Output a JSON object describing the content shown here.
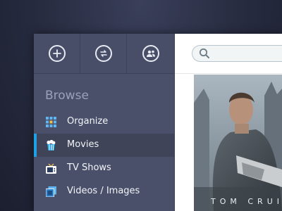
{
  "sidebar": {
    "heading": "Browse",
    "toolbar": [
      {
        "icon": "add-icon"
      },
      {
        "icon": "sync-icon"
      },
      {
        "icon": "users-icon"
      }
    ],
    "items": [
      {
        "label": "Organize",
        "icon": "grid-icon"
      },
      {
        "label": "Movies",
        "icon": "popcorn-icon",
        "active": true
      },
      {
        "label": "TV Shows",
        "icon": "tv-icon"
      },
      {
        "label": "Videos / Images",
        "icon": "media-icon"
      }
    ]
  },
  "content": {
    "search": {
      "placeholder": ""
    },
    "poster": {
      "title_text": "TOM CRUI"
    }
  },
  "colors": {
    "accent": "#1ea2e6",
    "sidebar_bg": "#4a506a",
    "active_bg": "#3f4459"
  }
}
